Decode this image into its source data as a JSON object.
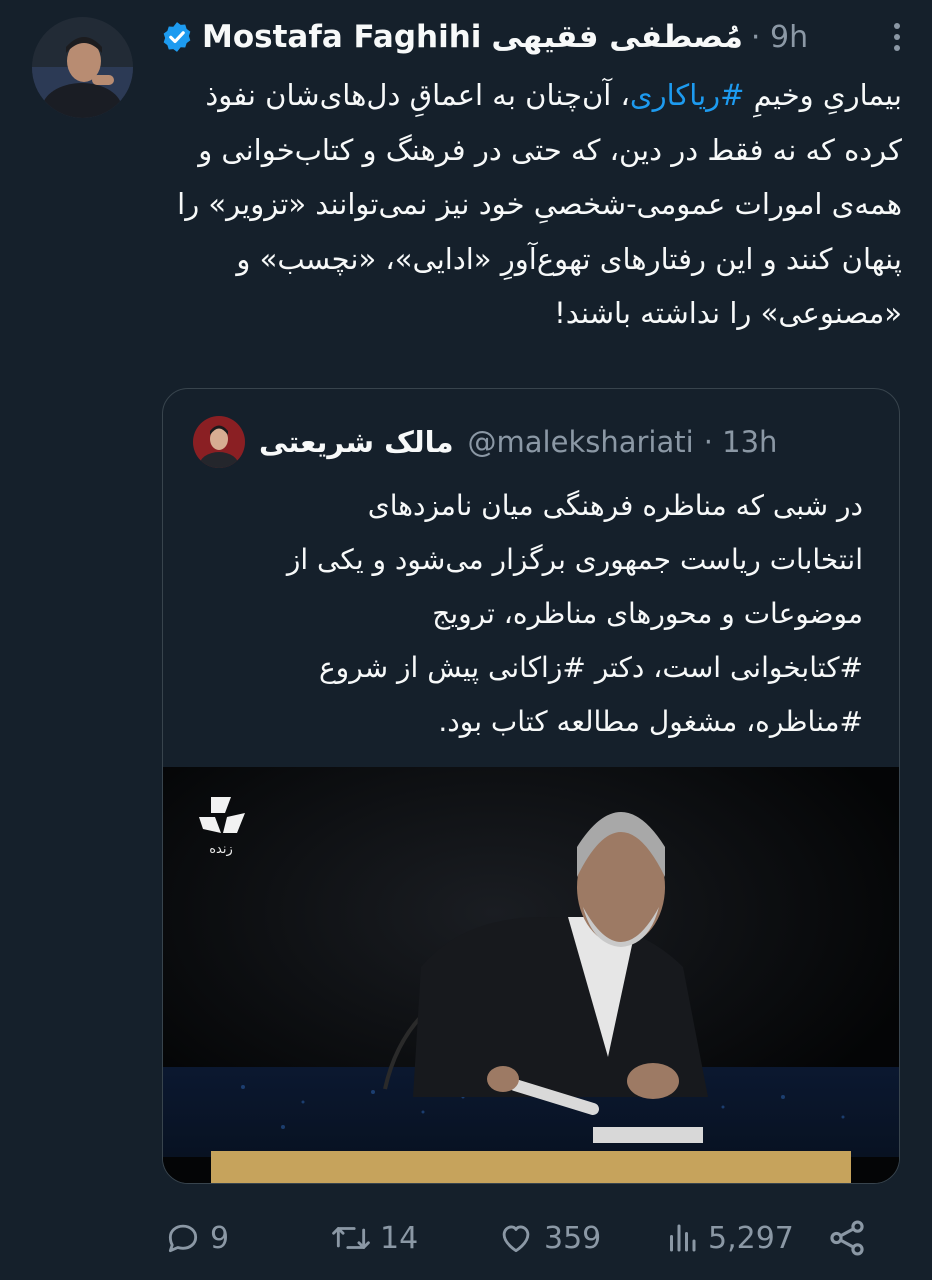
{
  "tweet": {
    "author_name_en": "Mostafa Faghihi",
    "author_name_fa": "مُصطفی فقیهی",
    "time": "· 9h",
    "text_before": "بیماریِ وخیمِ ",
    "hashtag": "#ریاکاری",
    "text_after": "، آن‌چنان به اعماقِ دل‌های‌شان نفوذ کرده که نه فقط در دین، که حتی در فرهنگ و کتاب‌خوانی و همه‌ی امورات عمومی-شخصیِ خود نیز نمی‌توانند «تزویر» را پنهان کنند و این رفتارهای تهوع‌آورِ «ادایی»، «نچسب» و «مصنوعی» را نداشته باشند!"
  },
  "quoted": {
    "name": "مالک شریعتی",
    "handle": "@malekshariati",
    "time": "· 13h",
    "lines": [
      "در شبی که مناظره فرهنگی میان نامزدهای",
      "انتخابات ریاست جمهوری برگزار می‌شود و یکی از",
      "موضوعات و محورهای مناظره، ترویج",
      "#کتابخوانی است، دکتر #زاکانی پیش از شروع",
      "#مناظره، مشغول مطالعه کتاب بود."
    ],
    "media_label": "زنده"
  },
  "actions": {
    "replies": "9",
    "retweets": "14",
    "likes": "359",
    "views": "5,297"
  },
  "colors": {
    "background": "#15202b",
    "accent": "#1d9bf0",
    "muted": "#8b98a5",
    "border": "#38444d"
  },
  "icons": [
    "verified-badge-icon",
    "more-icon",
    "reply-icon",
    "retweet-icon",
    "like-icon",
    "views-icon",
    "share-icon"
  ]
}
